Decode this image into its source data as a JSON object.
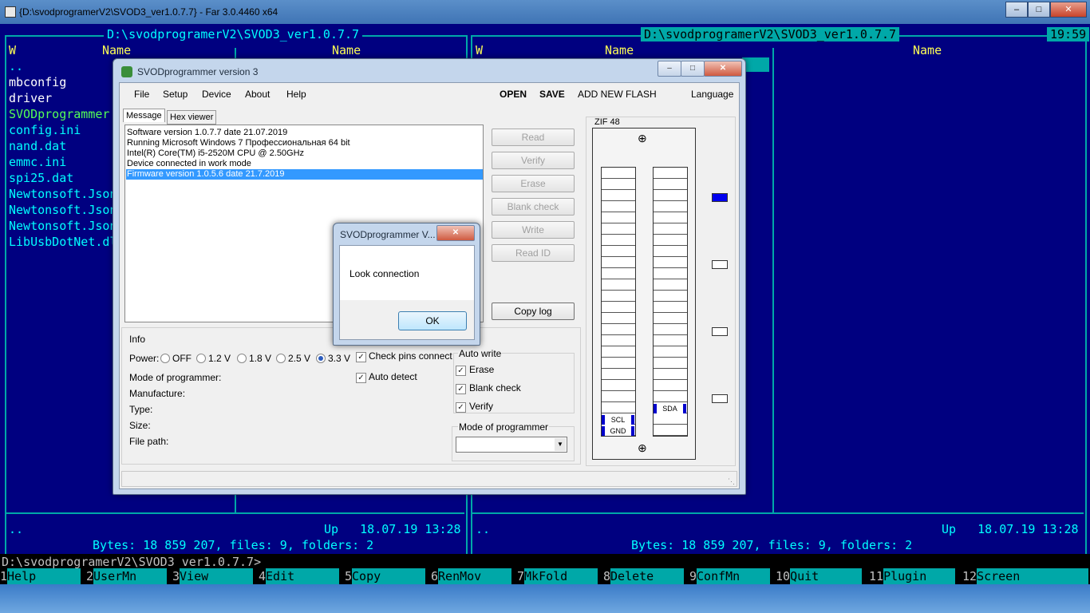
{
  "far": {
    "window_title": "{D:\\svodprogramerV2\\SVOD3_ver1.0.7.7} - Far 3.0.4460 x64",
    "left_panel": {
      "path": " D:\\svodprogramerV2\\SVOD3_ver1.0.7.7 ",
      "col_w": "W",
      "col_name1": "Name",
      "col_name2": "Name",
      "files": [
        "..",
        "mbconfig",
        "driver",
        "SVODprogrammer",
        "config.ini",
        "nand.dat",
        "emmc.ini",
        "spi25.dat",
        "Newtonsoft.Json",
        "Newtonsoft.Json",
        "Newtonsoft.Json",
        "LibUsbDotNet.dl"
      ],
      "bottom_name": "..",
      "bottom_info": "Up   18.07.19 13:28",
      "summary": " Bytes: 18 859 207, files: 9, folders: 2 "
    },
    "right_panel": {
      "path": " D:\\svodprogramerV2\\SVOD3_ver1.0.7.7 ",
      "clock": "19:59",
      "col_w": "W",
      "col_name1": "Name",
      "col_name2": "Name",
      "bottom_name": "..",
      "bottom_info": "Up   18.07.19 13:28",
      "summary": " Bytes: 18 859 207, files: 9, folders: 2 "
    },
    "command_line": "D:\\svodprogramerV2\\SVOD3_ver1.0.7.7>",
    "keybar": [
      {
        "n": "1",
        "label": "Help"
      },
      {
        "n": "2",
        "label": "UserMn"
      },
      {
        "n": "3",
        "label": "View"
      },
      {
        "n": "4",
        "label": "Edit"
      },
      {
        "n": "5",
        "label": "Copy"
      },
      {
        "n": "6",
        "label": "RenMov"
      },
      {
        "n": "7",
        "label": "MkFold"
      },
      {
        "n": "8",
        "label": "Delete"
      },
      {
        "n": "9",
        "label": "ConfMn"
      },
      {
        "n": "10",
        "label": "Quit"
      },
      {
        "n": "11",
        "label": "Plugin"
      },
      {
        "n": "12",
        "label": "Screen"
      }
    ]
  },
  "svod": {
    "title": "SVODprogrammer version 3",
    "menu": [
      "File",
      "Setup",
      "Device",
      "About",
      "Help"
    ],
    "menu_right": [
      "OPEN",
      "SAVE",
      "ADD NEW FLASH"
    ],
    "language": "Language",
    "tabs": [
      "Message",
      "Hex viewer"
    ],
    "messages": [
      "Software version 1.0.7.7 date 21.07.2019",
      "Running Microsoft Windows 7 Профессиональная  64 bit",
      "Intel(R) Core(TM) i5-2520M CPU @ 2.50GHz",
      "Device connected in work mode",
      "Firmware version 1.0.5.6 date 21.7.2019"
    ],
    "buttons": [
      "Read",
      "Verify",
      "Erase",
      "Blank check",
      "Write",
      "Read ID"
    ],
    "copy_log": "Copy log",
    "info": {
      "title": "Info",
      "power_label": "Power:",
      "power_options": [
        "OFF",
        "1.2 V",
        "1.8 V",
        "2.5 V",
        "3.3 V"
      ],
      "power_selected": "3.3 V",
      "check_pins": "Check pins connect",
      "auto_detect": "Auto detect",
      "mode_label": "Mode of programmer:",
      "manufacture": "Manufacture:",
      "type": "Type:",
      "size": "Size:",
      "file_path": "File path:"
    },
    "auto_write": {
      "title": "Auto write",
      "items": [
        "Erase",
        "Blank check",
        "Verify"
      ]
    },
    "mode_group": "Mode of programmer",
    "zif": {
      "title": "ZIF 48",
      "scl": "SCL",
      "gnd": "GND",
      "sda": "SDA"
    }
  },
  "popup": {
    "title": "SVODprogrammer V...",
    "message": "Look connection",
    "ok": "OK"
  }
}
